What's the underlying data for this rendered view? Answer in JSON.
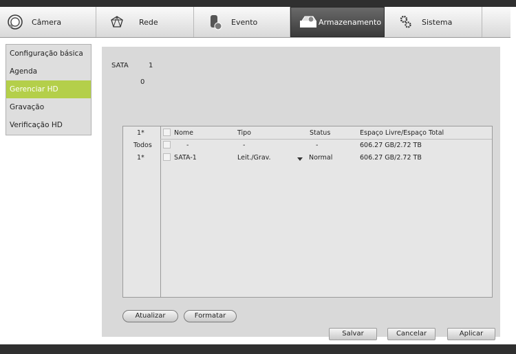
{
  "tabs": [
    {
      "label": "Câmera",
      "icon": "camera-icon"
    },
    {
      "label": "Rede",
      "icon": "network-icon"
    },
    {
      "label": "Evento",
      "icon": "event-icon"
    },
    {
      "label": "Armazenamento",
      "icon": "storage-icon",
      "active": true
    },
    {
      "label": "Sistema",
      "icon": "system-gears-icon"
    }
  ],
  "menu": {
    "items": [
      "Configuração básica",
      "Agenda",
      "Gerenciar HD",
      "Gravação",
      "Verificação HD"
    ],
    "active_index": 2
  },
  "info": {
    "sata_label": "SATA",
    "sata_number": "1",
    "zero": "0"
  },
  "table": {
    "header": {
      "id": "1*",
      "name": "Nome",
      "type": "Tipo",
      "status": "Status",
      "space": "Espaço Livre/Espaço Total"
    },
    "rows": [
      {
        "id": "Todos",
        "name": "-",
        "type": "-",
        "status": "-",
        "space": "606.27 GB/2.72 TB"
      },
      {
        "id": "1*",
        "name": "SATA-1",
        "type": "Leit./Grav.",
        "status": "Normal",
        "space": "606.27 GB/2.72 TB"
      }
    ]
  },
  "buttons": {
    "refresh": "Atualizar",
    "format": "Formatar",
    "save": "Salvar",
    "cancel": "Cancelar",
    "apply": "Aplicar"
  },
  "colors": {
    "active_menu": "#b4cf4a",
    "active_tab": "#4a4a4a",
    "panel": "#d9d9d9"
  }
}
